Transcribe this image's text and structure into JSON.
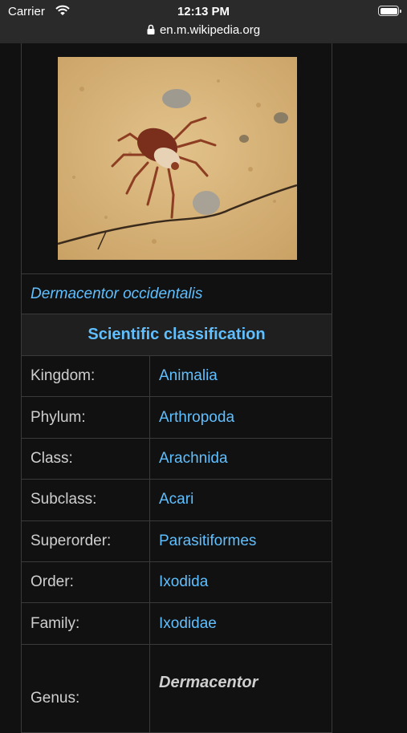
{
  "status": {
    "carrier": "Carrier",
    "time": "12:13 PM"
  },
  "browser": {
    "url": "en.m.wikipedia.org"
  },
  "infobox": {
    "caption": "Dermacentor occidentalis",
    "section_title": "Scientific classification",
    "rows": [
      {
        "label": "Kingdom:",
        "value": "Animalia"
      },
      {
        "label": "Phylum:",
        "value": "Arthropoda"
      },
      {
        "label": "Class:",
        "value": "Arachnida"
      },
      {
        "label": "Subclass:",
        "value": "Acari"
      },
      {
        "label": "Superorder:",
        "value": "Parasitiformes"
      },
      {
        "label": "Order:",
        "value": "Ixodida"
      },
      {
        "label": "Family:",
        "value": "Ixodidae"
      },
      {
        "label": "Genus:",
        "value": "Dermacentor"
      }
    ]
  },
  "colors": {
    "link": "#5fbfff",
    "background": "#111111",
    "border": "#3a3a3a"
  },
  "icons": [
    "wifi-icon",
    "battery-icon",
    "lock-icon"
  ]
}
